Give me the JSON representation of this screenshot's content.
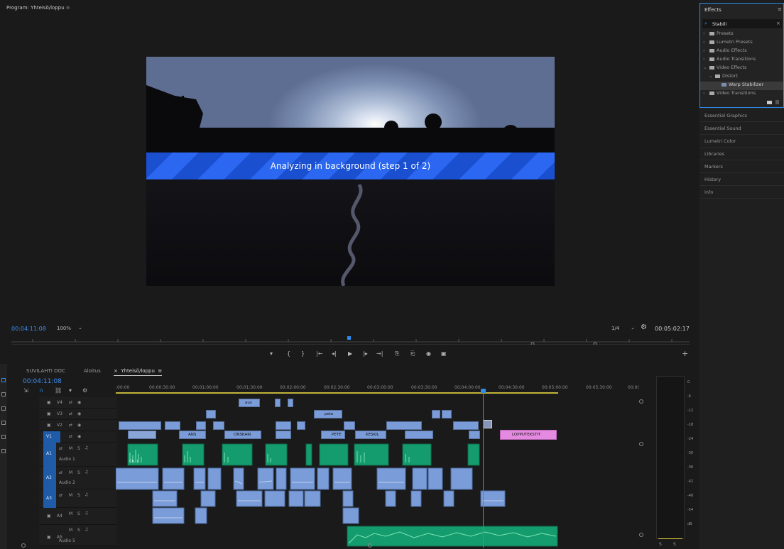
{
  "program": {
    "title": "Program: Yhteisö/loppu",
    "menu_glyph": "≡",
    "overlay_text": "Analyzing in background (step 1 of 2)",
    "timecode_current": "00:04:11:08",
    "zoom": "100%",
    "zoom_arrow": "⌄",
    "resolution": "1/4",
    "resolution_arrow": "⌄",
    "wrench": "🔧",
    "timecode_duration": "00:05:02:17",
    "transport": [
      "▾",
      "{",
      "}",
      "|←",
      "◂|",
      "▶",
      "|▸",
      "→|",
      "⎘",
      "⎗",
      "◉",
      "▣"
    ],
    "add_glyph": "+"
  },
  "effects": {
    "title": "Effects",
    "menu_glyph": "≡",
    "search_value": "Stabili",
    "search_clear": "×",
    "tree": [
      {
        "label": "Presets",
        "level": 0,
        "expanded": false
      },
      {
        "label": "Lumetri Presets",
        "level": 0,
        "expanded": false
      },
      {
        "label": "Audio Effects",
        "level": 0,
        "expanded": false
      },
      {
        "label": "Audio Transitions",
        "level": 0,
        "expanded": false
      },
      {
        "label": "Video Effects",
        "level": 0,
        "expanded": true
      },
      {
        "label": "Distort",
        "level": 1,
        "expanded": true
      },
      {
        "label": "Warp Stabilizer",
        "level": 2,
        "expanded": false
      },
      {
        "label": "Video Transitions",
        "level": 0,
        "expanded": false
      }
    ]
  },
  "right_panels": [
    "Essential Graphics",
    "Essential Sound",
    "Lumetri Color",
    "Libraries",
    "Markers",
    "History",
    "Info"
  ],
  "timeline": {
    "tabs": [
      "SUVILAHTI DOC",
      "Aloitus",
      "Yhteisö/loppu"
    ],
    "active_tab_close": "×",
    "active_tab_menu": "≡",
    "timecode": "00:04:11:08",
    "ruler": [
      ":00:00",
      "00:00:30:00",
      "00:01:00:00",
      "00:01:30:00",
      "00:02:00:00",
      "00:02:30:00",
      "00:03:00:00",
      "00:03:30:00",
      "00:04:00:00",
      "00:04:30:00",
      "00:05:00:00",
      "00:05:30:00",
      "00:0("
    ],
    "video_tracks": [
      "V4",
      "V3",
      "V2",
      "V1"
    ],
    "audio_tracks": [
      {
        "id": "A1",
        "name": "Audio 1"
      },
      {
        "id": "A2",
        "name": "Audio 2"
      },
      {
        "id": "A3",
        "name": ""
      },
      {
        "id": "A4",
        "name": ""
      },
      {
        "id": "A5",
        "name": "Audio 5"
      }
    ],
    "track_buttons": {
      "lock": "🔒",
      "sync": "⇆",
      "eye": "👁",
      "mute": "M",
      "solo": "S",
      "mic": "🎙"
    },
    "clip_labels": {
      "v4_clip": "aus",
      "v3_clip": "pete",
      "v1_ans": "ANS",
      "v1_onskari": "ONSKARI",
      "v1_pete": "PETE",
      "v1_keskil": "KESKIL",
      "v1_lopputekstit": "LOPPUTEKSTIT",
      "a1_ch": "Ch. 1"
    },
    "accent_colors": {
      "playhead": "#2d8cf0",
      "video_clip": "#7a9cd8",
      "audio1_clip": "#149c6e",
      "title_clip": "#e48ae0"
    }
  },
  "meter": {
    "scale": [
      "0",
      "-6",
      "-12",
      "-18",
      "-24",
      "-30",
      "-36",
      "-42",
      "-48",
      "-54",
      "dB"
    ],
    "solo_labels": [
      "S",
      "S"
    ]
  }
}
